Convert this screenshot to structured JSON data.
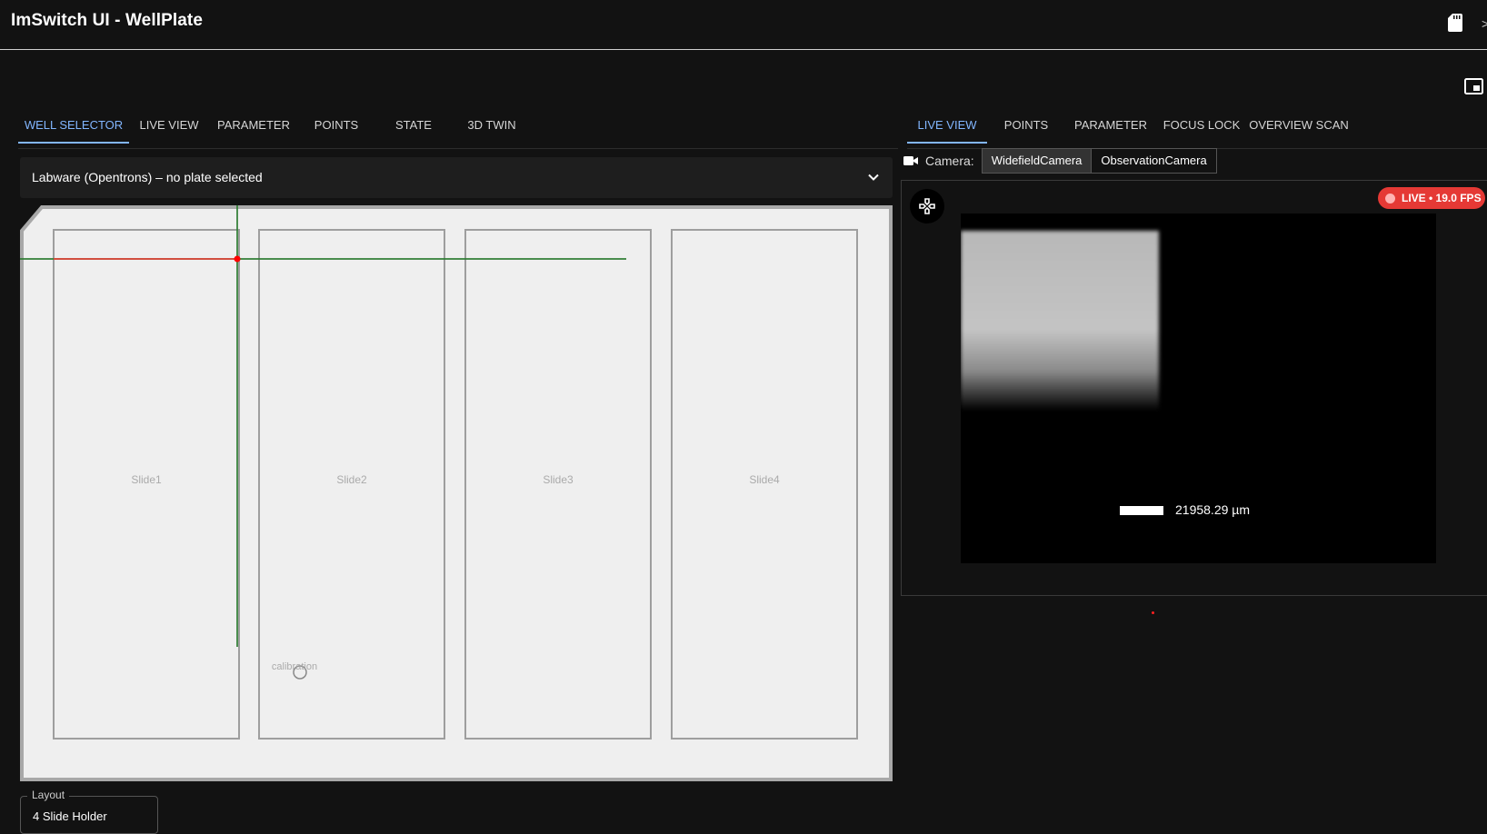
{
  "app": {
    "title": "ImSwitch UI - WellPlate",
    "edge_mark": ">"
  },
  "left_tabs": [
    {
      "label": "WELL SELECTOR",
      "active": true
    },
    {
      "label": "LIVE VIEW",
      "active": false
    },
    {
      "label": "PARAMETER",
      "active": false
    },
    {
      "label": "POINTS",
      "active": false
    },
    {
      "label": "STATE",
      "active": false
    },
    {
      "label": "3D TWIN",
      "active": false
    }
  ],
  "right_tabs": [
    {
      "label": "LIVE VIEW",
      "active": true
    },
    {
      "label": "POINTS",
      "active": false
    },
    {
      "label": "PARAMETER",
      "active": false
    },
    {
      "label": "FOCUS LOCK",
      "active": false
    },
    {
      "label": "OVERVIEW SCAN",
      "active": false
    }
  ],
  "labware": {
    "title": "Labware (Opentrons) – no plate selected"
  },
  "plate": {
    "slides": [
      "Slide1",
      "Slide2",
      "Slide3",
      "Slide4"
    ],
    "calibration_label": "calibration"
  },
  "layout": {
    "legend": "Layout",
    "value": "4 Slide Holder"
  },
  "camera": {
    "label": "Camera:",
    "options": [
      "WidefieldCamera",
      "ObservationCamera"
    ],
    "selected": "WidefieldCamera"
  },
  "live": {
    "badge": "LIVE • 19.0 FPS",
    "scale_text": "21958.29 µm"
  },
  "colors": {
    "accent": "#82b6ff",
    "live_red": "#e53935",
    "crosshair": "#2e7d32",
    "marker": "#ff0000"
  },
  "icons": [
    "sd-card-icon",
    "picture-in-picture-icon",
    "chevron-down-icon",
    "videocam-icon",
    "gamepad-icon"
  ]
}
